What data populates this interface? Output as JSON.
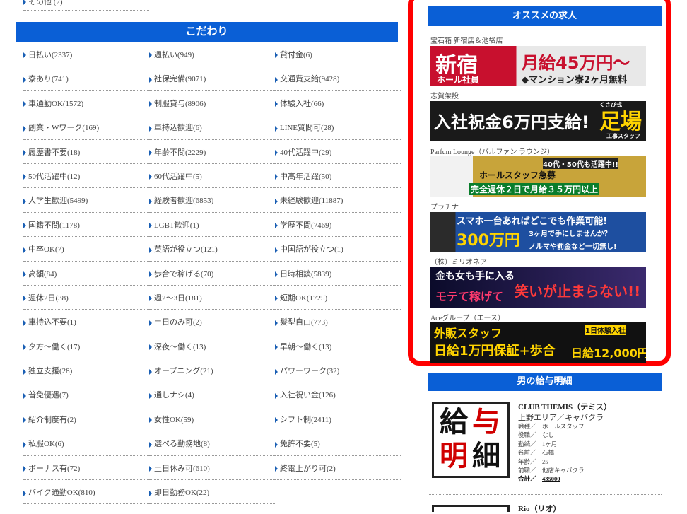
{
  "top_item": "その他 (2)",
  "kodawari": {
    "title": "こだわり",
    "items": [
      "日払い(2337)",
      "週払い(949)",
      "貸付金(6)",
      "寮あり(741)",
      "社保完備(9071)",
      "交通費支給(9428)",
      "車通勤OK(1572)",
      "制服貸与(8906)",
      "体験入社(66)",
      "副業・Wワーク(169)",
      "車持込歓迎(6)",
      "LINE質問可(28)",
      "履歴書不要(18)",
      "年齢不問(2229)",
      "40代活躍中(29)",
      "50代活躍中(12)",
      "60代活躍中(5)",
      "中高年活躍(50)",
      "大学生歓迎(5499)",
      "経験者歓迎(6853)",
      "未経験歓迎(11887)",
      "国籍不問(1178)",
      "LGBT歓迎(1)",
      "学歴不問(7469)",
      "中卒OK(7)",
      "英語が役立つ(121)",
      "中国語が役立つ(1)",
      "高額(84)",
      "歩合で稼げる(70)",
      "日時相談(5839)",
      "週休2日(38)",
      "週2～3日(181)",
      "短期OK(1725)",
      "車持込不要(1)",
      "土日のみ可(2)",
      "髪型自由(773)",
      "夕方～働く(17)",
      "深夜～働く(13)",
      "早朝～働く(13)",
      "独立支援(28)",
      "オープニング(21)",
      "パワーワーク(32)",
      "普免優遇(7)",
      "通しナシ(4)",
      "入社祝い金(126)",
      "紹介制度有(2)",
      "女性OK(59)",
      "シフト制(2411)",
      "私服OK(6)",
      "選べる勤務地(8)",
      "免許不要(5)",
      "ボーナス有(72)",
      "土日休み可(610)",
      "終電上がり可(2)",
      "バイク通勤OK(810)",
      "即日勤務OK(22)",
      ""
    ]
  },
  "recommend": {
    "title": "オススメの求人",
    "shops": [
      {
        "name": "宝石箱 新宿店＆池袋店",
        "banner_lines": [
          "新宿",
          "ホール社員",
          "月給45万円～",
          "◆マンション寮2ヶ月無料"
        ]
      },
      {
        "name": "志賀架設",
        "banner_lines": [
          "入社祝金6万円支給!",
          "足場",
          "くさび式",
          "工事スタッフ"
        ]
      },
      {
        "name": "Parfum Lounge（パルファン ラウンジ）",
        "banner_lines": [
          "ホールスタッフ急募",
          "40代・50代も活躍中!!",
          "完全週休２日で月給３５万円以上"
        ]
      },
      {
        "name": "プラチナ",
        "banner_lines": [
          "スマホ一台あればどこでも作業可能!",
          "300万円",
          "3ヶ月で手にしませんか？",
          "ノルマや罰金など一切無し!"
        ]
      },
      {
        "name": "（株）ミリオネア",
        "banner_lines": [
          "金も女も手に入る",
          "モテて稼げて",
          "笑いが止まらない!!"
        ]
      },
      {
        "name": "Aceグループ（エース）",
        "banner_lines": [
          "外販スタッフ",
          "日給1万円保証+歩合",
          "1日体験入社",
          "日給12,000円"
        ]
      }
    ]
  },
  "salary": {
    "title": "男の給与明細",
    "icon_chars": [
      "給",
      "与",
      "明",
      "細"
    ],
    "club_name": "CLUB THEMIS（テミス）",
    "area": "上野エリア／キャバクラ",
    "details": [
      {
        "k": "職種／",
        "v": "ホールスタッフ"
      },
      {
        "k": "役職／",
        "v": "なし"
      },
      {
        "k": "勤続／",
        "v": "1ヶ月"
      },
      {
        "k": "名前／",
        "v": "石橋"
      },
      {
        "k": "年齢／",
        "v": "25"
      },
      {
        "k": "前職／",
        "v": "他店キャバクラ"
      }
    ],
    "total_label": "合計／",
    "total_value": "435000",
    "next_name": "Rio（リオ）"
  },
  "colors": {
    "accent_blue": "#0a5fd6",
    "highlight_red": "#ff0000"
  }
}
